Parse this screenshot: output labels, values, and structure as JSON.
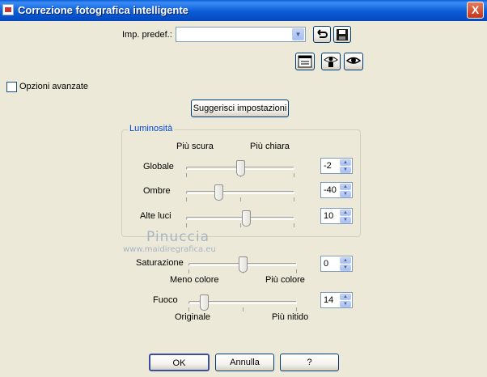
{
  "window": {
    "title": "Correzione fotografica intelligente",
    "close": "X"
  },
  "preset": {
    "label": "Imp. predef.:",
    "value": ""
  },
  "advanced": {
    "label": "Opzioni avanzate",
    "checked": false
  },
  "suggest_button": "Suggerisci impostazioni",
  "brightness": {
    "group_label": "Luminosità",
    "left_caption": "Più scura",
    "right_caption": "Più chiara",
    "rows": [
      {
        "label": "Globale",
        "value": "-2",
        "level": 0.5
      },
      {
        "label": "Ombre",
        "value": "-40",
        "level": 0.3
      },
      {
        "label": "Alte luci",
        "value": "10",
        "level": 0.55
      }
    ]
  },
  "saturation": {
    "label": "Saturazione",
    "value": "0",
    "level": 0.5,
    "left_caption": "Meno colore",
    "right_caption": "Più colore"
  },
  "focus": {
    "label": "Fuoco",
    "value": "14",
    "level": 0.14,
    "left_caption": "Originale",
    "right_caption": "Più nitido"
  },
  "watermark": {
    "name": "Pinuccia",
    "url": "www.maidiregrafica.eu"
  },
  "buttons": {
    "ok": "OK",
    "cancel": "Annulla",
    "help": "?"
  }
}
